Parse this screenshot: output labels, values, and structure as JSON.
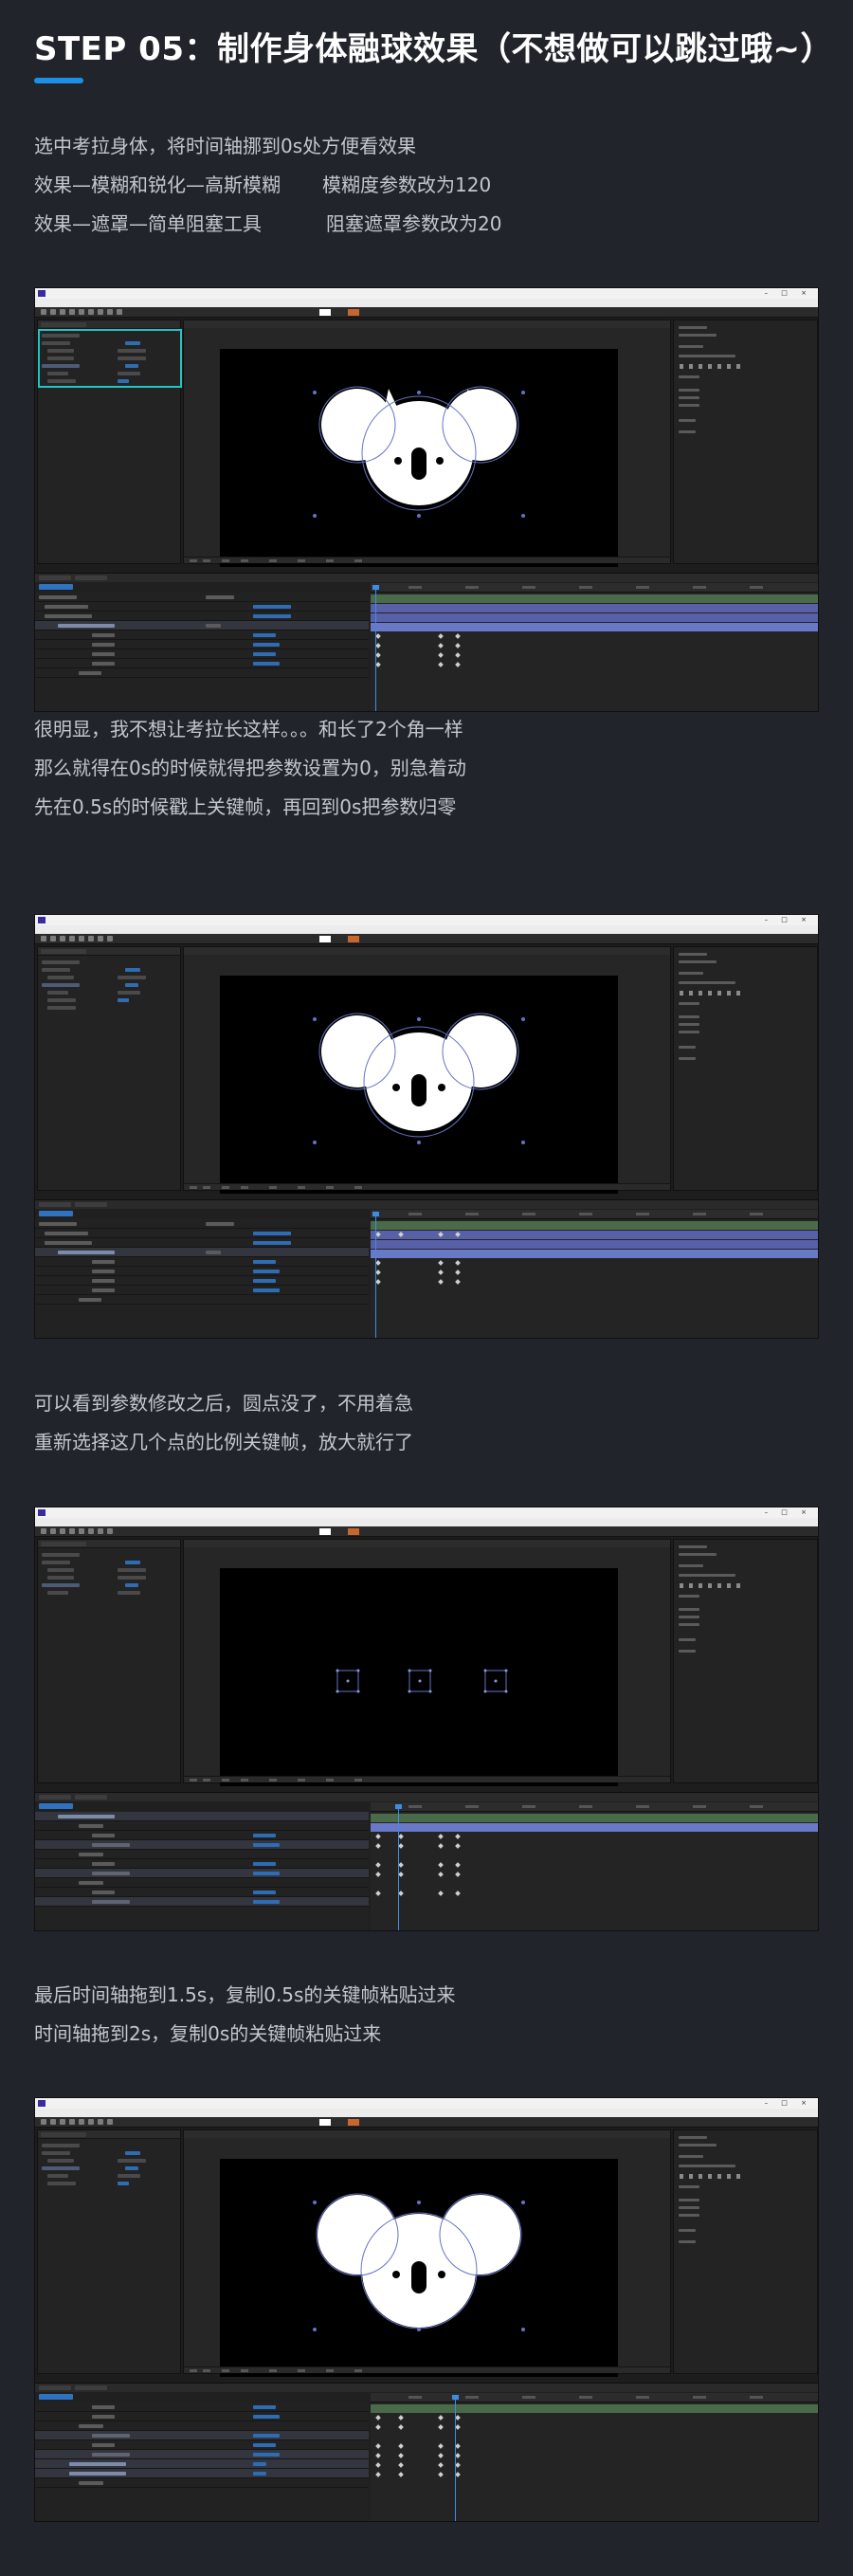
{
  "title": "STEP 05：制作身体融球效果（不想做可以跳过哦~）",
  "colors": {
    "background": "#21242b",
    "title": "#ffffff",
    "accent": "#1c8fe6",
    "body_text": "#c4c7cd",
    "selection_outline": "#23c4c4"
  },
  "paragraphs": {
    "p1": {
      "line1": "选中考拉身体，将时间轴挪到0s处方便看效果",
      "line2_a": "效果—模糊和锐化—高斯模糊",
      "line2_b": "模糊度参数改为120",
      "line3_a": "效果—遮罩—简单阻塞工具",
      "line3_b": "阻塞遮罩参数改为20"
    },
    "p2": {
      "line1": "很明显，我不想让考拉长这样。。。和长了2个角一样",
      "line2": "那么就得在0s的时候就得把参数设置为0，别急着动",
      "line3": "先在0.5s的时候戳上关键帧，再回到0s把参数归零"
    },
    "p3": {
      "line1": "可以看到参数修改之后，圆点没了，不用着急",
      "line2": "重新选择这几个点的比例关键帧，放大就行了"
    },
    "p4": {
      "line1": "最后时间轴拖到1.5s，复制0.5s的关键帧粘贴过来",
      "line2": "时间轴拖到2s，复制0s的关键帧粘贴过来"
    }
  },
  "icons": {
    "app_logo": "after-effects-icon",
    "window_controls": "window-controls-icon",
    "keyframe": "keyframe-diamond-icon",
    "playhead": "playhead-icon"
  }
}
